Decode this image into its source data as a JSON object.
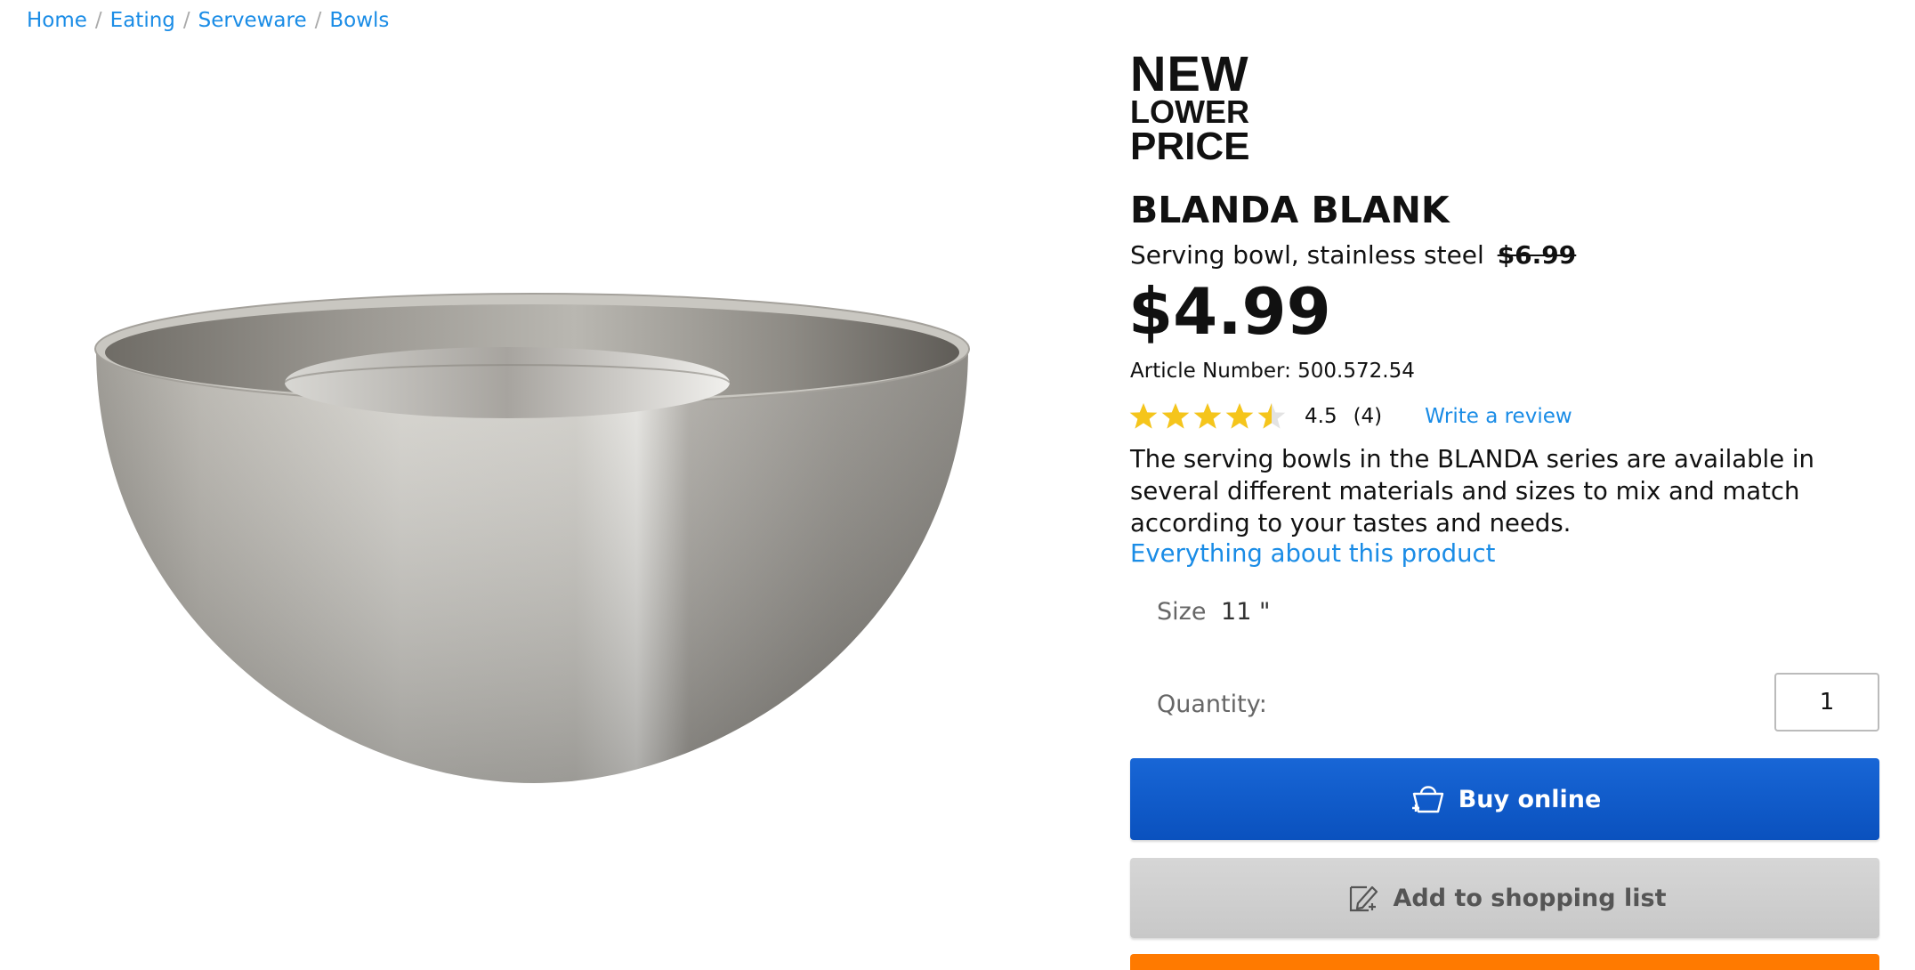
{
  "breadcrumb": {
    "items": [
      "Home",
      "Eating",
      "Serveware",
      "Bowls"
    ],
    "separator": "/"
  },
  "product": {
    "image_alt": "stainless steel serving bowl",
    "promo_badge": {
      "line1": "NEW",
      "line2": "LOWER",
      "line3": "PRICE"
    },
    "name": "BLANDA BLANK",
    "short_description": "Serving bowl, stainless steel",
    "old_price": "$6.99",
    "price": "$4.99",
    "article_number_label": "Article Number:",
    "article_number": "500.572.54",
    "rating": {
      "value": "4.5",
      "stars_out_of_5": 4.5,
      "count": "(4)",
      "write_review_label": "Write a review",
      "star_color": "#f5c51b"
    },
    "description": "The serving bowls in the BLANDA series are available in several different materials and sizes to mix and match according to your tastes and needs.",
    "everything_link": "Everything about this product",
    "size_label": "Size",
    "size_value": "11 \"",
    "quantity_label": "Quantity:",
    "quantity_value": "1",
    "buy_button_label": "Buy online",
    "buy_button_icon": "shopping-basket-icon",
    "list_button_label": "Add to shopping list",
    "list_button_icon": "edit-list-icon"
  },
  "colors": {
    "link": "#1a8ce6",
    "buy_button": "#0e58c8",
    "list_button": "#d0d0d0",
    "orange_button": "#ff7a00"
  }
}
